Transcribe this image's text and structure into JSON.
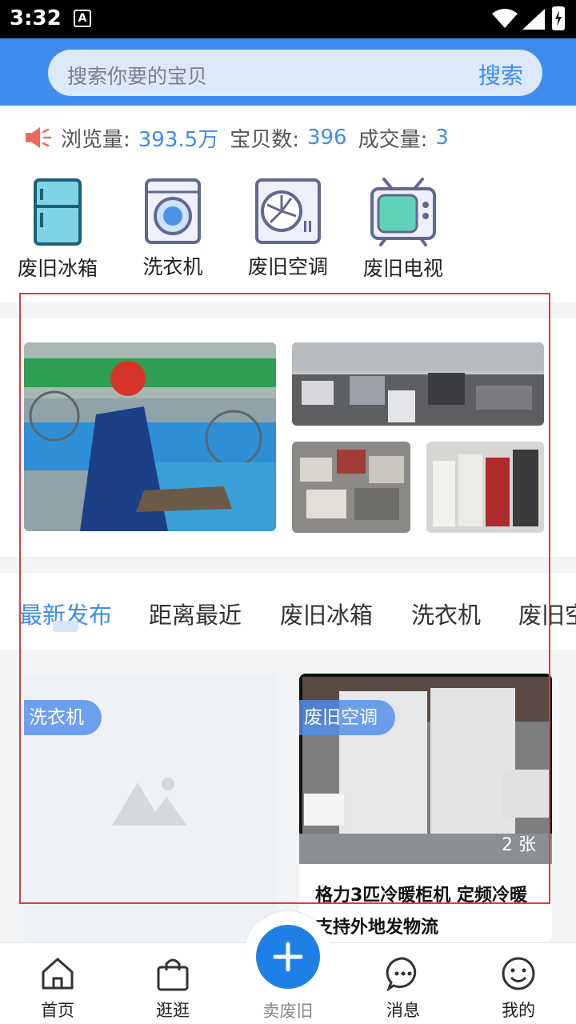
{
  "status_bar": {
    "time": "3:32",
    "notification_icon": "A"
  },
  "search": {
    "placeholder": "搜索你要的宝贝",
    "button": "搜索"
  },
  "stats": {
    "views_label": "浏览量:",
    "views_value": "393.5万",
    "items_label": "宝贝数:",
    "items_value": "396",
    "deals_label": "成交量:",
    "deals_value": "3"
  },
  "categories": [
    {
      "label": "废旧冰箱",
      "icon": "fridge-icon"
    },
    {
      "label": "洗衣机",
      "icon": "washing-machine-icon"
    },
    {
      "label": "废旧空调",
      "icon": "air-conditioner-icon"
    },
    {
      "label": "废旧电视",
      "icon": "tv-icon"
    }
  ],
  "tabs": [
    {
      "label": "最新发布",
      "active": true
    },
    {
      "label": "距离最近"
    },
    {
      "label": "废旧冰箱"
    },
    {
      "label": "洗衣机"
    },
    {
      "label": "废旧空"
    }
  ],
  "feed": [
    {
      "tag": "洗衣机",
      "image": "placeholder-image-icon",
      "title": ""
    },
    {
      "tag": "废旧空调",
      "photo_count": "2 张",
      "title": "格力3匹冷暖柜机 定频冷暖支持外地发物流"
    }
  ],
  "bottom_nav": [
    {
      "label": "首页",
      "icon": "home-icon"
    },
    {
      "label": "逛逛",
      "icon": "shopping-bag-icon"
    },
    {
      "label": "卖废旧",
      "icon": "plus-icon"
    },
    {
      "label": "消息",
      "icon": "message-icon"
    },
    {
      "label": "我的",
      "icon": "smile-icon"
    }
  ],
  "colors": {
    "brand": "#3f8ced",
    "fab": "#1e7fe6",
    "background": "#f3f4f6",
    "highlight_frame": "#e03b3b"
  }
}
